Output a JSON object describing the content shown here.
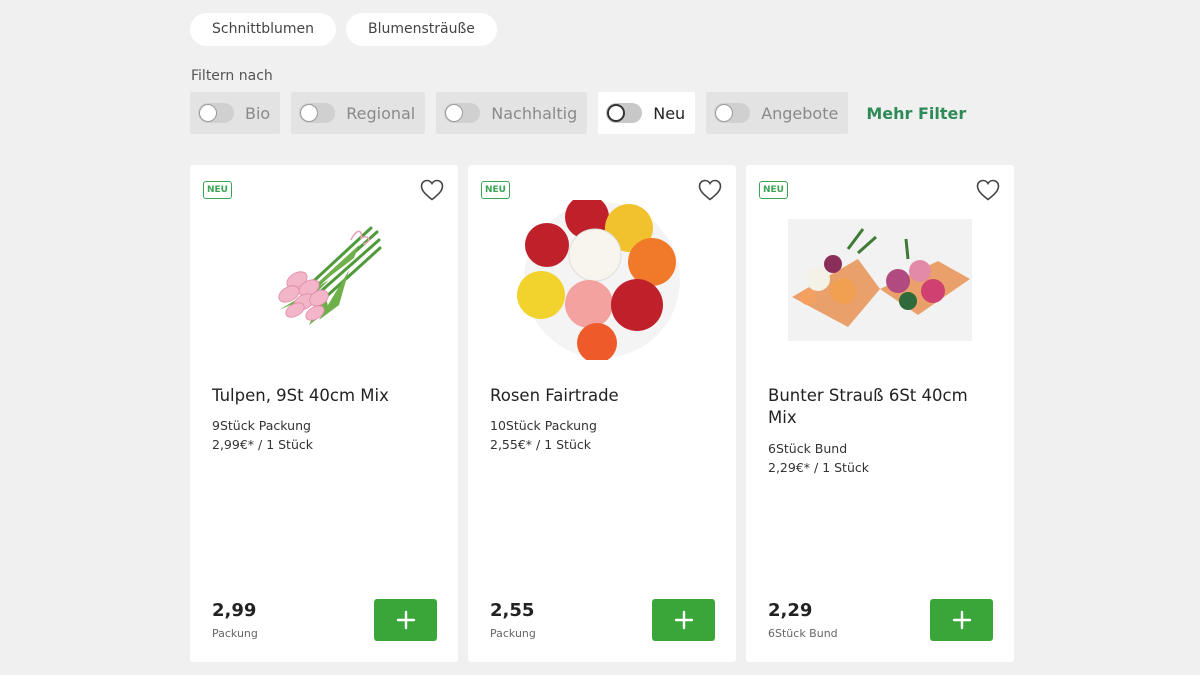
{
  "categories": [
    "Schnittblumen",
    "Blumensträuße"
  ],
  "filter_label": "Filtern nach",
  "filters": [
    {
      "label": "Bio",
      "active": false
    },
    {
      "label": "Regional",
      "active": false
    },
    {
      "label": "Nachhaltig",
      "active": false
    },
    {
      "label": "Neu",
      "active": true
    },
    {
      "label": "Angebote",
      "active": false
    }
  ],
  "more_filter": "Mehr Filter",
  "colors": {
    "accent_green": "#3aa63a",
    "link_green": "#2e8b57",
    "background": "#f0f0f0"
  },
  "products": [
    {
      "badge": "NEU",
      "name": "Tulpen, 9St 40cm Mix",
      "pack": "9Stück Packung",
      "unit_price": "2,99€* / 1 Stück",
      "price": "2,99",
      "price_unit": "Packung",
      "image": "pink-tulips-bouquet"
    },
    {
      "badge": "NEU",
      "name": "Rosen Fairtrade",
      "pack": "10Stück Packung",
      "unit_price": "2,55€* / 1 Stück",
      "price": "2,55",
      "price_unit": "Packung",
      "image": "mixed-roses-bouquet"
    },
    {
      "badge": "NEU",
      "name": "Bunter Strauß 6St 40cm Mix",
      "pack": "6Stück Bund",
      "unit_price": "2,29€* / 1 Stück",
      "price": "2,29",
      "price_unit": "6Stück Bund",
      "image": "mixed-flower-bouquets"
    }
  ],
  "icons": {
    "favorite": "heart-outline-icon",
    "add": "plus-icon"
  }
}
